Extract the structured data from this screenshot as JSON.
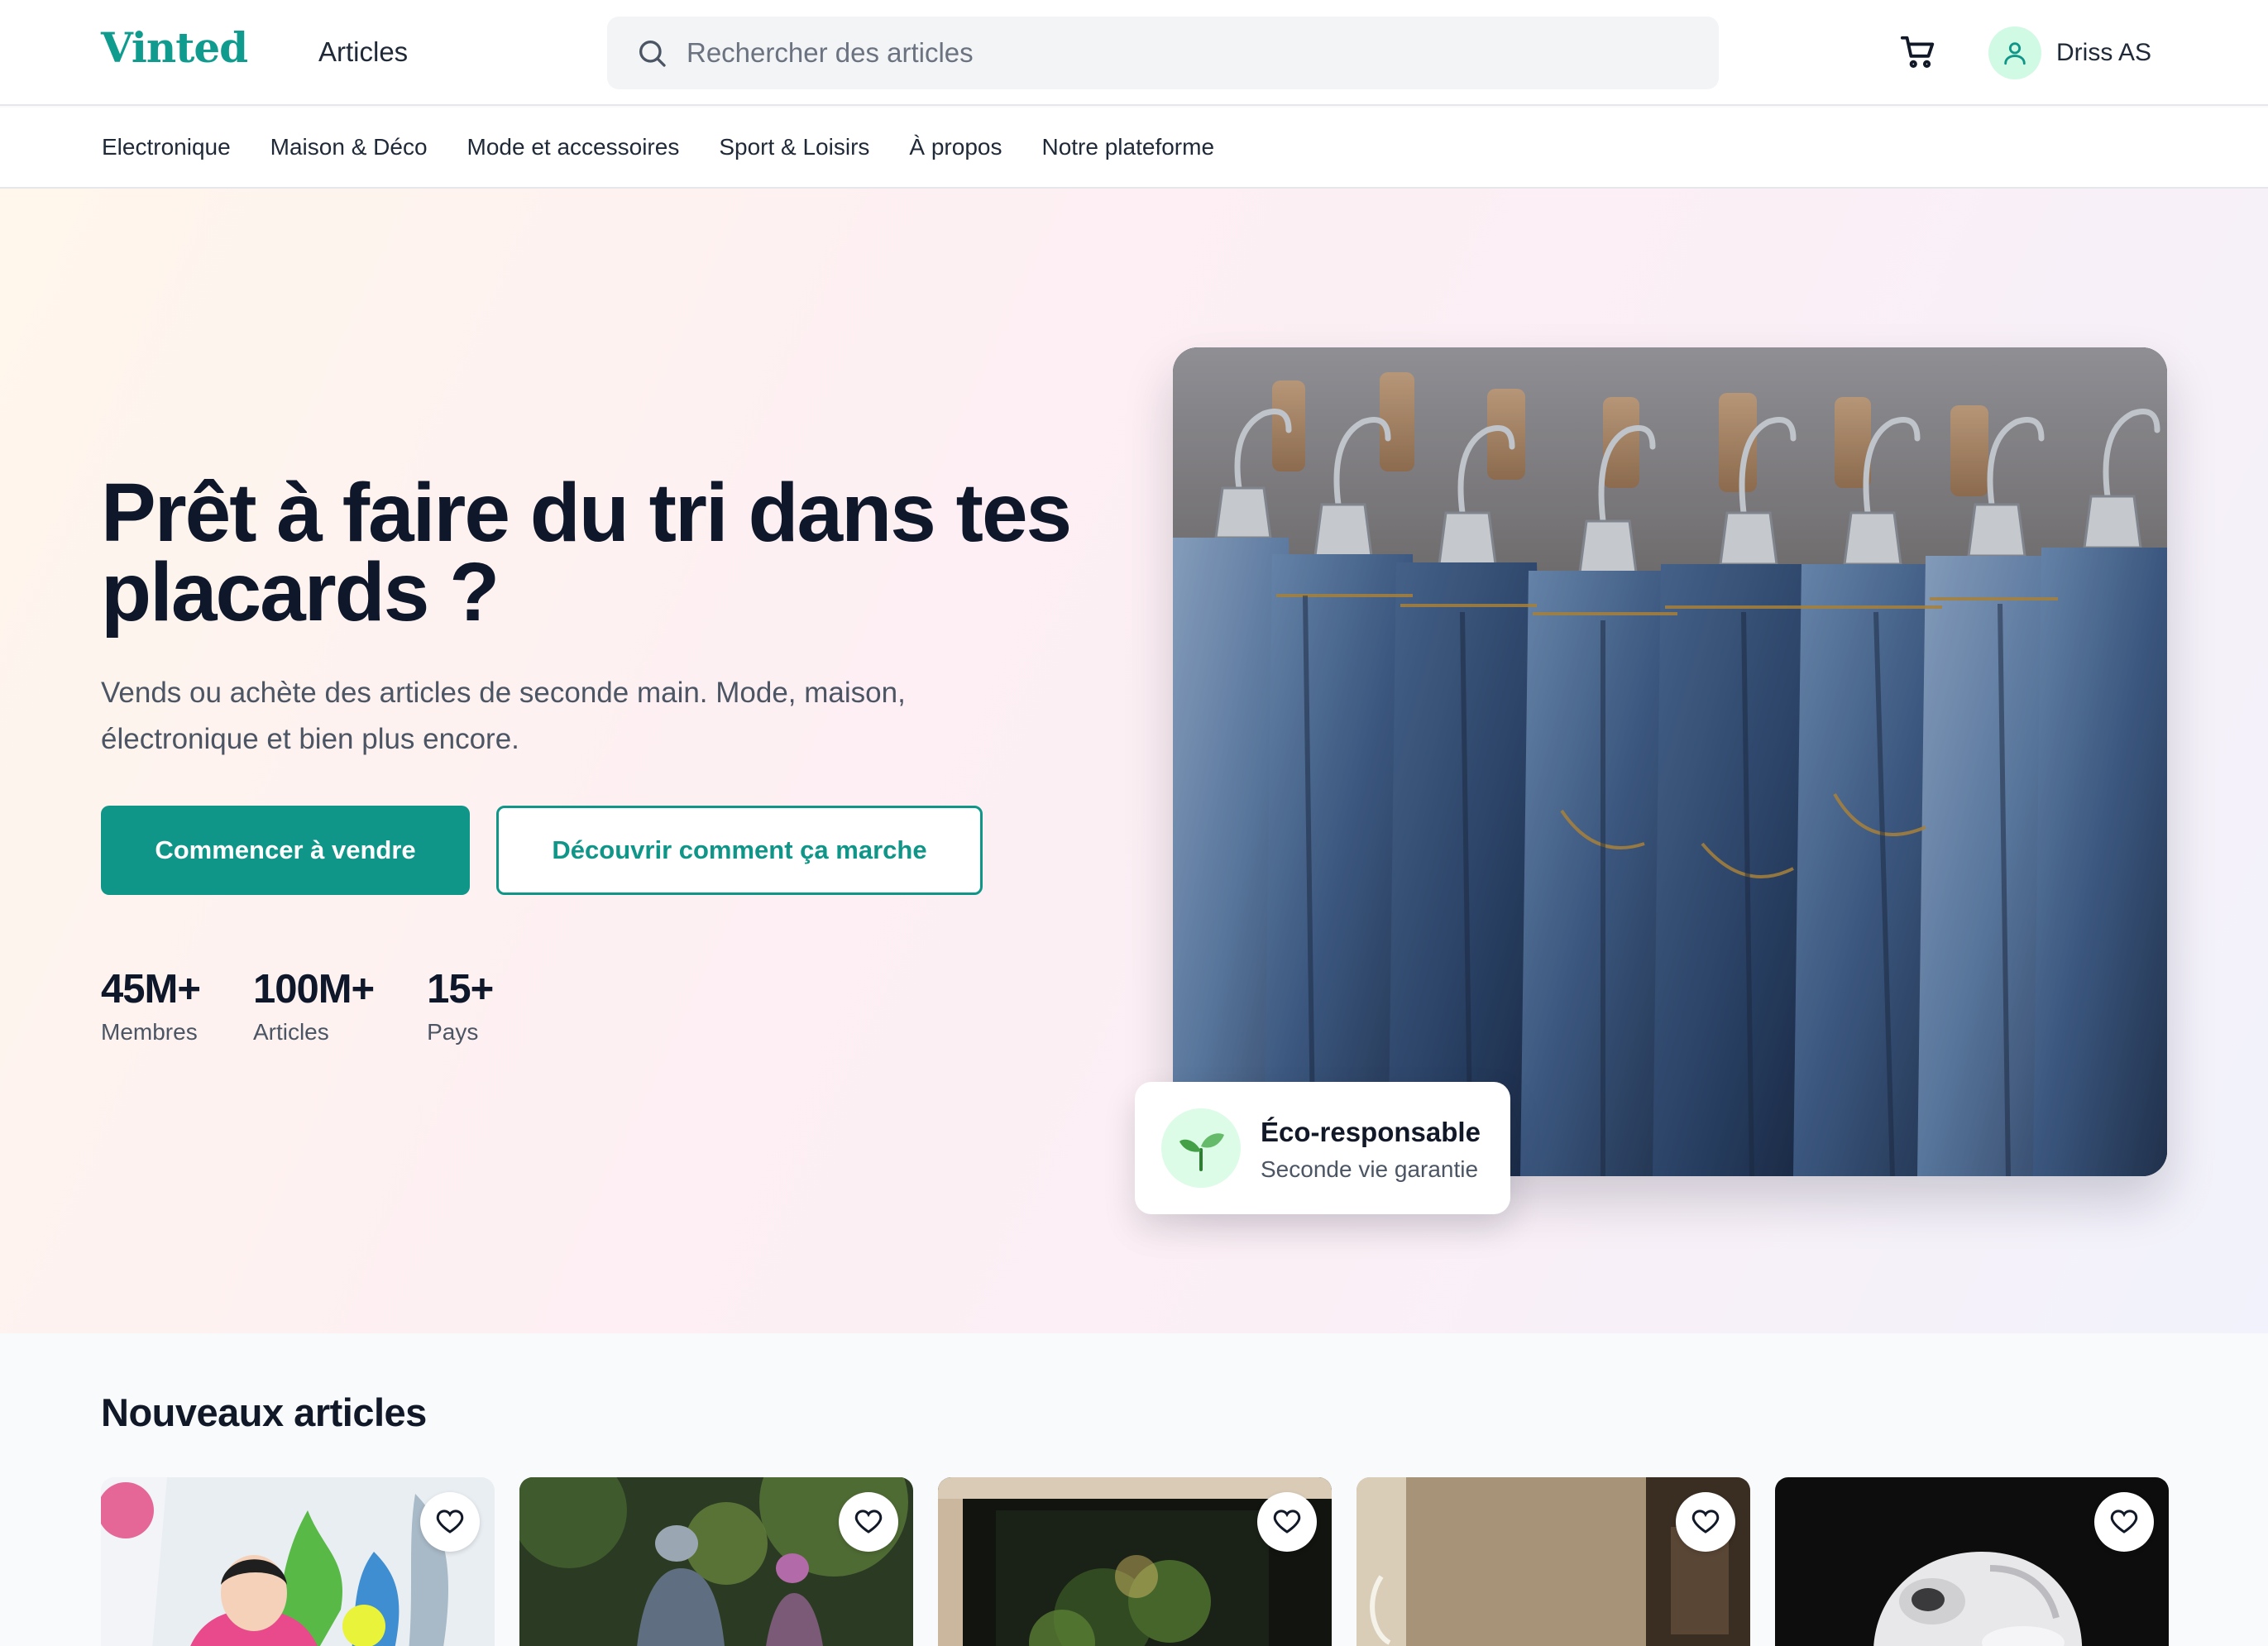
{
  "header": {
    "logo": "Vinted",
    "nav_link": "Articles",
    "search_placeholder": "Rechercher des articles",
    "user_name": "Driss AS"
  },
  "categories": [
    "Electronique",
    "Maison & Déco",
    "Mode et accessoires",
    "Sport & Loisirs",
    "À propos",
    "Notre plateforme"
  ],
  "hero": {
    "title": "Prêt à faire du tri dans tes placards ?",
    "subtitle": "Vends ou achète des articles de seconde main. Mode, maison, électronique et bien plus encore.",
    "primary_cta": "Commencer à vendre",
    "secondary_cta": "Découvrir comment ça marche",
    "stats": [
      {
        "value": "45M+",
        "label": "Membres"
      },
      {
        "value": "100M+",
        "label": "Articles"
      },
      {
        "value": "15+",
        "label": "Pays"
      }
    ],
    "badge": {
      "title": "Éco-responsable",
      "subtitle": "Seconde vie garantie"
    }
  },
  "new_items": {
    "title": "Nouveaux articles",
    "cards": [
      {
        "image": "person-colorful-wall-photo"
      },
      {
        "image": "cyclists-forest-photo"
      },
      {
        "image": "plants-window-night-photo"
      },
      {
        "image": "interior-doorway-photo"
      },
      {
        "image": "earbuds-case-photo"
      }
    ]
  },
  "colors": {
    "brand": "#0f9688",
    "text": "#0f172a",
    "muted": "#4b5563"
  }
}
